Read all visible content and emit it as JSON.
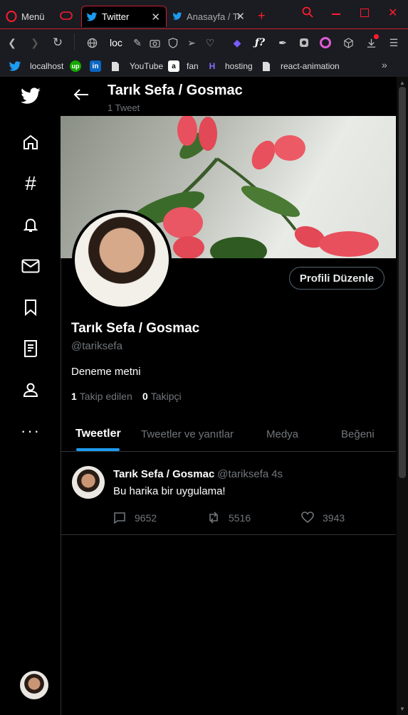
{
  "browser": {
    "menu_label": "Menü",
    "tabs": [
      {
        "title": "Twitter"
      },
      {
        "title": "Anasayfa / Tw"
      }
    ],
    "address": "loc",
    "bookmarks": [
      {
        "label": "localhost"
      },
      {
        "label": ""
      },
      {
        "label": ""
      },
      {
        "label": "YouTube"
      },
      {
        "label": "fan"
      },
      {
        "label": "hosting"
      },
      {
        "label": "react-animation"
      }
    ],
    "accent_color": "#c72132"
  },
  "profile": {
    "header_name": "Tarık Sefa / Gosmac",
    "header_count": "1 Tweet",
    "edit_button": "Profili Düzenle",
    "name": "Tarık Sefa / Gosmac",
    "handle": "@tariksefa",
    "bio": "Deneme metni",
    "following_count": "1",
    "following_label": "Takip edilen",
    "followers_count": "0",
    "followers_label": "Takipçi"
  },
  "tabs": [
    {
      "label": "Tweetler"
    },
    {
      "label": "Tweetler ve yanıtlar"
    },
    {
      "label": "Medya"
    },
    {
      "label": "Beğeni"
    }
  ],
  "tweet": {
    "name": "Tarık Sefa / Gosmac",
    "handle": "@tariksefa",
    "time": "4s",
    "text": "Bu harika bir uygulama!",
    "replies": "9652",
    "retweets": "5516",
    "likes": "3943"
  },
  "colors": {
    "twitter_blue": "#1d9bf0",
    "muted": "#71767b"
  }
}
